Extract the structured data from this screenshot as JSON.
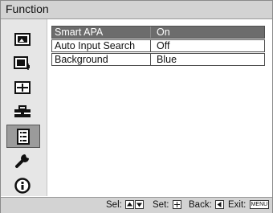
{
  "window": {
    "title": "Function"
  },
  "sidebar": {
    "items": [
      {
        "name": "picture",
        "icon": "picture-icon"
      },
      {
        "name": "picture-adjust",
        "icon": "picture-adjust-icon"
      },
      {
        "name": "screen",
        "icon": "screen-icon"
      },
      {
        "name": "setup",
        "icon": "toolbox-icon"
      },
      {
        "name": "function",
        "icon": "function-list-icon",
        "active": true
      },
      {
        "name": "installation",
        "icon": "wrench-icon"
      },
      {
        "name": "information",
        "icon": "info-icon"
      }
    ]
  },
  "menu": {
    "rows": [
      {
        "label": "Smart APA",
        "value": "On",
        "selected": true
      },
      {
        "label": "Auto Input Search",
        "value": "Off",
        "selected": false
      },
      {
        "label": "Background",
        "value": "Blue",
        "selected": false
      }
    ]
  },
  "status": {
    "sel": "Sel:",
    "set": "Set:",
    "back": "Back:",
    "exit": "Exit:",
    "menu_key": "MENU"
  },
  "colors": {
    "highlight": "#6c6c6c",
    "titlebar": "#d3d3d3",
    "sidebar": "#e6e6e6"
  }
}
